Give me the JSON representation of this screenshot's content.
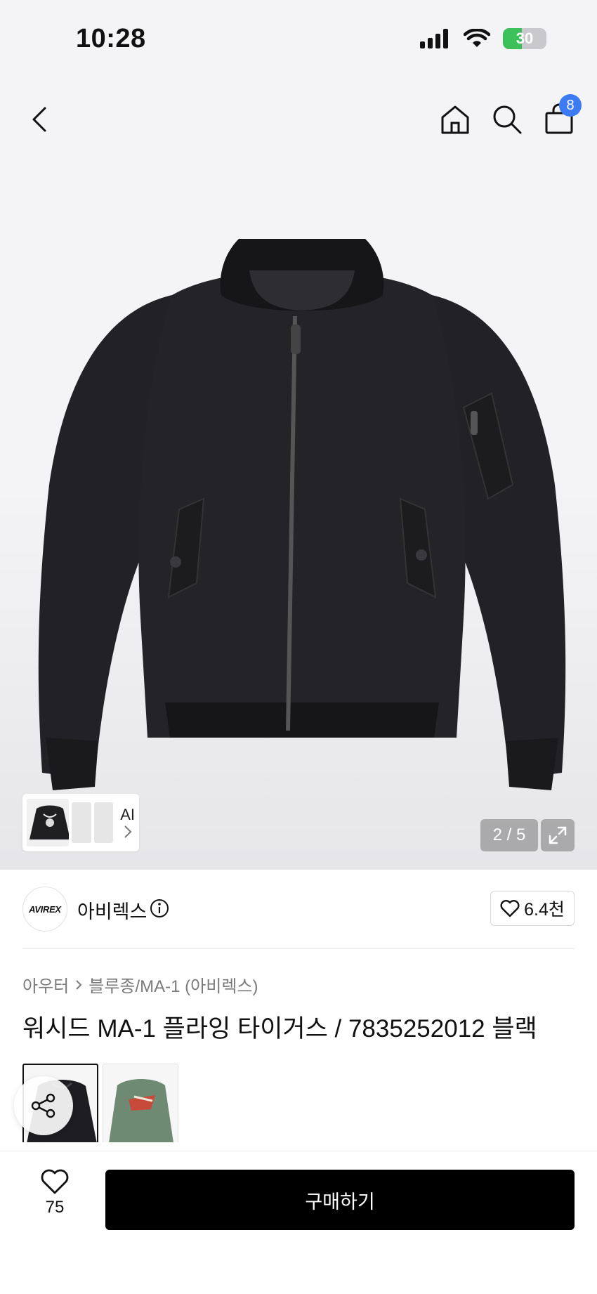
{
  "status": {
    "time": "10:28",
    "battery": "30"
  },
  "nav": {
    "cart_count": "8"
  },
  "gallery": {
    "ai_label": "AI",
    "pager": "2 / 5"
  },
  "brand": {
    "logo_text": "AVIREX",
    "name": "아비렉스",
    "likes": "6.4천"
  },
  "breadcrumb": {
    "category": "아우터",
    "subcategory": "블루종/MA-1 (아비렉스)"
  },
  "product": {
    "title": "워시드 MA-1 플라잉 타이거스 / 7835252012 블랙"
  },
  "colors": {
    "selected": "black",
    "options": [
      "black",
      "green"
    ]
  },
  "bottom": {
    "wish_count": "75",
    "buy_label": "구매하기"
  },
  "theme": {
    "accent_badge": "#3d7bf5",
    "buy_button": "#000000",
    "battery_fill": "#3cc15a"
  }
}
